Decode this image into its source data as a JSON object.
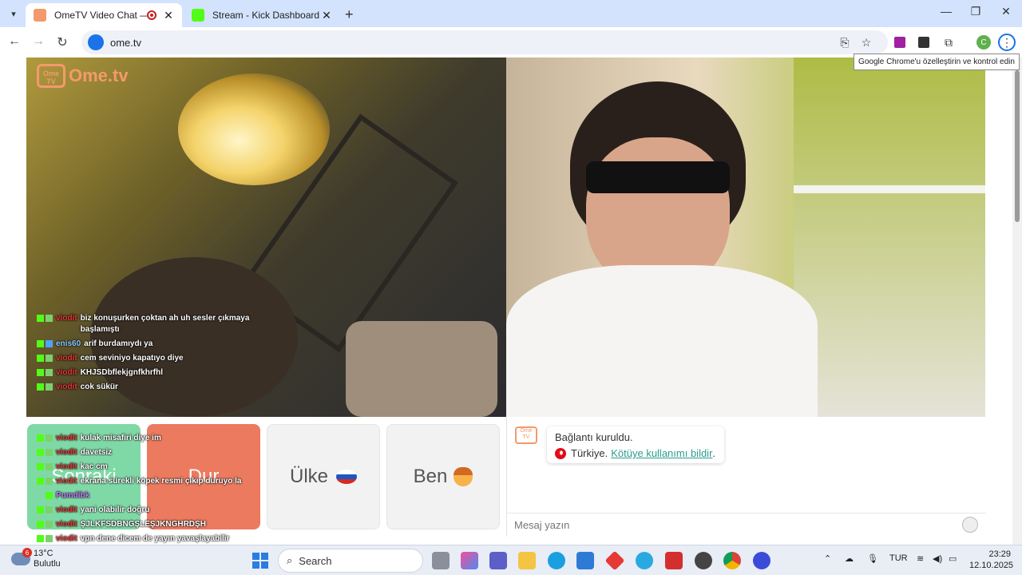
{
  "browser": {
    "tabs": [
      {
        "title": "OmeTV Video Chat — Ome",
        "active": true
      },
      {
        "title": "Stream - Kick Dashboard",
        "active": false
      }
    ],
    "url": "ome.tv",
    "tooltip": "Google Chrome'u özelleştirin ve kontrol edin",
    "profile_initial": "C"
  },
  "site": {
    "logo_text": "Ome.tv",
    "logo_badge": "Ome TV"
  },
  "chat_overlay": [
    {
      "user": "viodit",
      "message": "biz konuşurken çoktan ah uh sesler çıkmaya başlamıştı"
    },
    {
      "user": "enis60",
      "message": "arif burdamıydı ya"
    },
    {
      "user": "viodit",
      "message": "cem seviniyo kapatıyo diye"
    },
    {
      "user": "viodit",
      "message": "KHJSDbflekjgnfkhrfhl"
    },
    {
      "user": "viodit",
      "message": "cok sükür"
    },
    {
      "user": "viodit",
      "message": "kulak misafiri diye im"
    },
    {
      "user": "viodit",
      "message": "davetsiz"
    },
    {
      "user": "viodit",
      "message": "kac cm"
    },
    {
      "user": "viodit",
      "message": "ekrana sürekli köpek resmi çıkıp duruyo la"
    },
    {
      "user": "Pumdibk",
      "message": ""
    },
    {
      "user": "viodit",
      "message": "yani olabilir doğru"
    },
    {
      "user": "viodit",
      "message": "ŞJLKFSDBNGŞLEŞJKNGHRDŞH"
    },
    {
      "user": "viodit",
      "message": "vpn dene dicem de yayın yavaşlayabilir"
    }
  ],
  "controls": {
    "next_label": "Sonraki",
    "stop_label": "Dur",
    "country_label": "Ülke",
    "me_label": "Ben"
  },
  "panel": {
    "status": "Bağlantı kuruldu.",
    "country": "Türkiye.",
    "report_link": "Kötüye kullanımı bildir",
    "report_suffix": ".",
    "message_placeholder": "Mesaj yazın"
  },
  "taskbar": {
    "weather_temp": "13°C",
    "weather_desc": "Bulutlu",
    "weather_badge": "6",
    "search_placeholder": "Search",
    "language": "TUR",
    "time": "23:29",
    "date": "12.10.2025"
  }
}
